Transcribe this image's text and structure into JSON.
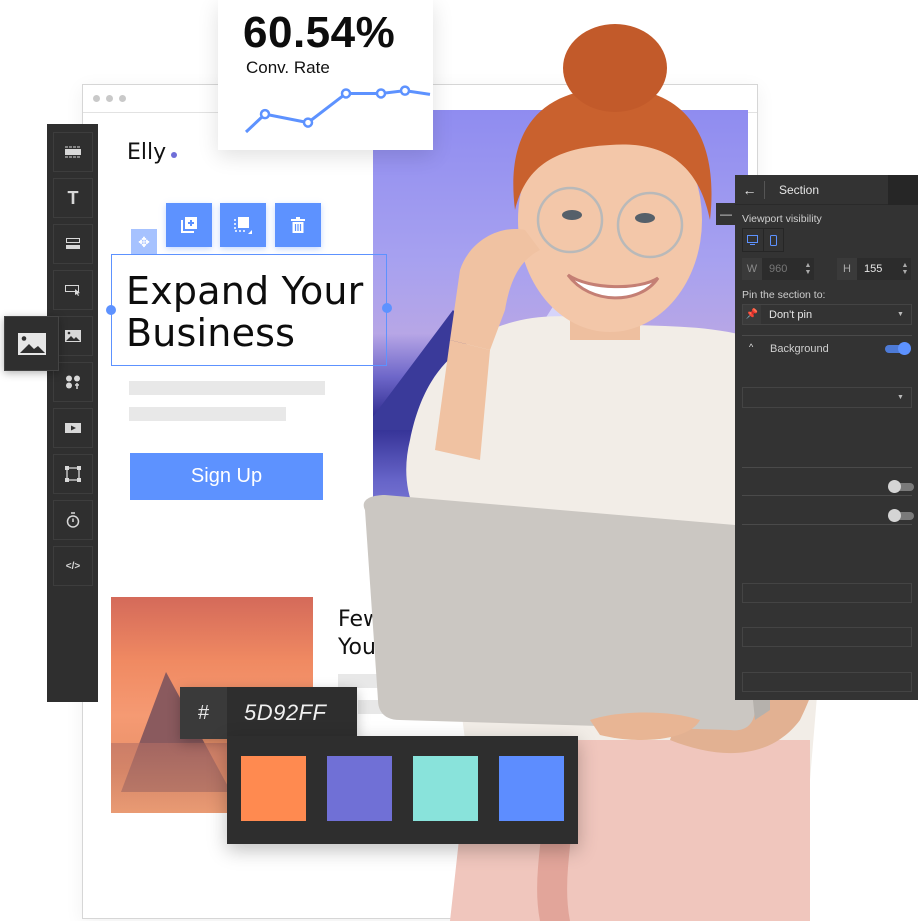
{
  "browser": {
    "logo": "Elly",
    "headline_line1": "Expand Your",
    "headline_line2": "Business",
    "signup_label": "Sign Up",
    "secondary_heading_line1": "Few",
    "secondary_heading_line2": "You"
  },
  "element_toolbar": {
    "buttons": [
      {
        "name": "duplicate",
        "icon": "add-copy-icon"
      },
      {
        "name": "resize",
        "icon": "resize-icon"
      },
      {
        "name": "delete",
        "icon": "trash-icon"
      }
    ],
    "move_handle_icon": "move-icon"
  },
  "sidebar": {
    "items": [
      {
        "name": "section",
        "icon": "section-icon"
      },
      {
        "name": "text",
        "icon": "text-icon"
      },
      {
        "name": "strip",
        "icon": "strip-icon"
      },
      {
        "name": "button",
        "icon": "button-cursor-icon"
      },
      {
        "name": "image",
        "icon": "image-icon"
      },
      {
        "name": "social",
        "icon": "social-icons-icon"
      },
      {
        "name": "video",
        "icon": "video-icon"
      },
      {
        "name": "shape",
        "icon": "shape-icon"
      },
      {
        "name": "timer",
        "icon": "timer-icon"
      },
      {
        "name": "code",
        "icon": "code-icon"
      }
    ],
    "active_popout": "image"
  },
  "conversion_card": {
    "value": "60.54%",
    "label": "Conv. Rate",
    "line_color": "#5d92ff",
    "trend": [
      0.0,
      0.38,
      0.2,
      0.82,
      0.82,
      0.88,
      0.8
    ]
  },
  "settings_panel": {
    "title": "Section",
    "viewport_visibility_label": "Viewport visibility",
    "width_key": "W",
    "width_value": "960",
    "height_key": "H",
    "height_value": "155",
    "pin_label": "Pin the section to:",
    "pin_value": "Don't pin",
    "background_label": "Background",
    "background_enabled": true,
    "toggle_2_enabled": false,
    "toggle_3_enabled": false
  },
  "color_picker": {
    "hash": "#",
    "hex": "5D92FF",
    "swatches": [
      "#ff8a50",
      "#7070d6",
      "#89e3db",
      "#5d8dff"
    ]
  },
  "colors": {
    "accent": "#5d92ff",
    "panel_bg": "#333333"
  }
}
